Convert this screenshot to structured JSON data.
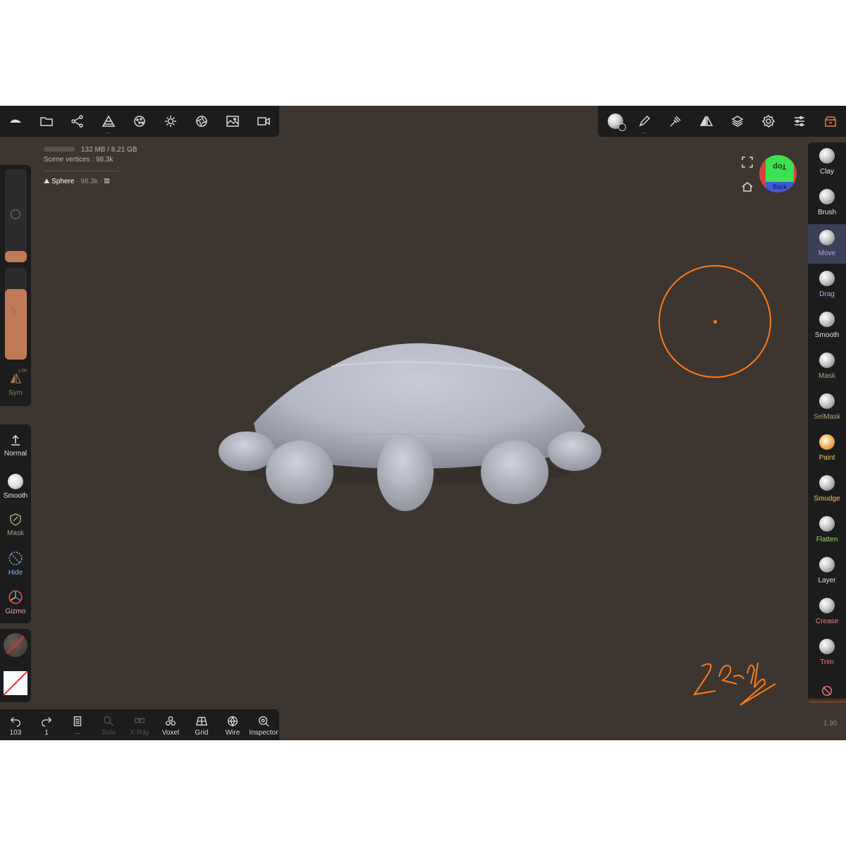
{
  "stats": {
    "memory": "132 MB / 8.21 GB",
    "vertices_label": "Scene vertices",
    "vertices_value": "98.3k",
    "object_name": "Sphere",
    "object_count": "· 98.3k ·"
  },
  "top_toolbar_left": {
    "icons": [
      "logo-icon",
      "folder-icon",
      "scene-graph-icon",
      "primitives-icon",
      "material-icon",
      "light-icon",
      "camera-settings-icon",
      "image-icon",
      "video-icon"
    ],
    "dots": "..."
  },
  "top_toolbar_right": {
    "icons": [
      "brush-material-icon",
      "stroke-icon",
      "tool-settings-icon",
      "symmetry-icon",
      "layers-icon",
      "settings-icon",
      "sliders-icon",
      "store-icon"
    ]
  },
  "viewcube": {
    "top": "Top",
    "back": "Back"
  },
  "left_panel": {
    "radius_fraction": 0.12,
    "intensity_fraction": 0.77,
    "sym_label": "Sym",
    "sym_sub": "L/W",
    "tools": [
      {
        "label": "Normal",
        "color": "#e0e0e0"
      },
      {
        "label": "Smooth",
        "color": "#e0e0e0"
      },
      {
        "label": "Mask",
        "color": "#b0a080"
      },
      {
        "label": "Hide",
        "color": "#7db0e8"
      },
      {
        "label": "Gizmo",
        "color": "#e0a0c0"
      }
    ]
  },
  "right_tools": [
    {
      "label": "Clay",
      "color": "#e0e0e0",
      "active": false
    },
    {
      "label": "Brush",
      "color": "#e0e0e0",
      "active": false
    },
    {
      "label": "Move",
      "color": "#a8a8e8",
      "active": true
    },
    {
      "label": "Drag",
      "color": "#a8a8e8",
      "active": false
    },
    {
      "label": "Smooth",
      "color": "#e0e0e0",
      "active": false
    },
    {
      "label": "Mask",
      "color": "#b0a080",
      "active": false
    },
    {
      "label": "SelMask",
      "color": "#b0a080",
      "active": false
    },
    {
      "label": "Paint",
      "color": "#f0c060",
      "active": false
    },
    {
      "label": "Smudge",
      "color": "#f0c060",
      "active": false
    },
    {
      "label": "Flatten",
      "color": "#90e060",
      "active": false
    },
    {
      "label": "Layer",
      "color": "#e0e0e0",
      "active": false
    },
    {
      "label": "Crease",
      "color": "#f08080",
      "active": false
    },
    {
      "label": "Trim",
      "color": "#f08080",
      "active": false
    }
  ],
  "bottom_toolbar": [
    {
      "label": "103",
      "icon": "undo-icon",
      "enabled": true
    },
    {
      "label": "1",
      "icon": "redo-icon",
      "enabled": true
    },
    {
      "label": "...",
      "icon": "file-icon",
      "enabled": true
    },
    {
      "label": "Solo",
      "icon": "solo-icon",
      "enabled": false
    },
    {
      "label": "X-Ray",
      "icon": "xray-icon",
      "enabled": false
    },
    {
      "label": "Voxel",
      "icon": "voxel-icon",
      "enabled": true
    },
    {
      "label": "Grid",
      "icon": "grid-icon",
      "enabled": true
    },
    {
      "label": "Wire",
      "icon": "wire-icon",
      "enabled": true
    },
    {
      "label": "Inspector",
      "icon": "inspector-icon",
      "enabled": true
    }
  ],
  "version": "1.90",
  "colors": {
    "accent": "#ff7a1a",
    "slider": "#c07a55",
    "active_tool_bg": "#3b3f57",
    "viewport_bg": "#3d3630"
  }
}
